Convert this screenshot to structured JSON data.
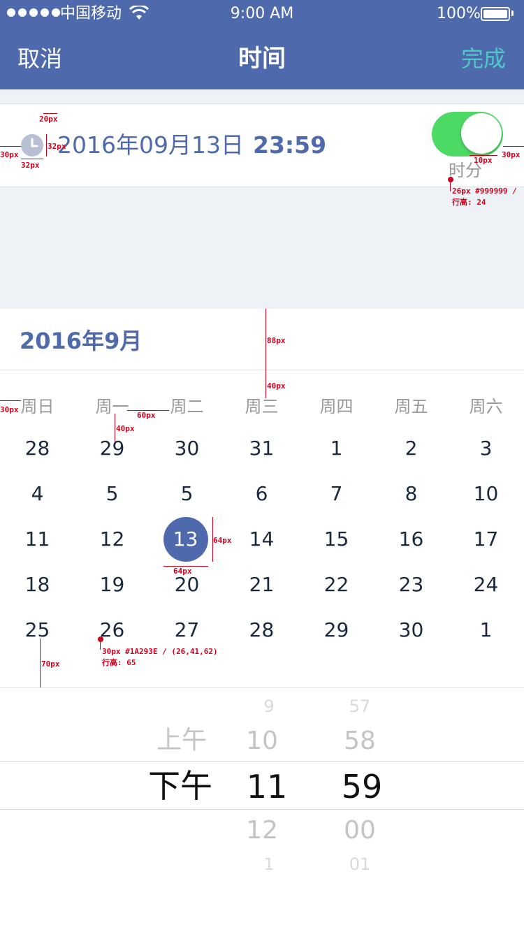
{
  "status_bar": {
    "carrier": "中国移动",
    "time": "9:00 AM",
    "battery": "100%"
  },
  "nav": {
    "cancel": "取消",
    "title": "时间",
    "done": "完成"
  },
  "date_row": {
    "date": "2016年09月13日",
    "time": "23:59",
    "toggle_on": true,
    "toggle_label": "时分"
  },
  "calendar": {
    "title": "2016年9月",
    "weekdays": [
      "周日",
      "周一",
      "周二",
      "周三",
      "周四",
      "周五",
      "周六"
    ],
    "weeks": [
      [
        "28",
        "29",
        "30",
        "31",
        "1",
        "2",
        "3"
      ],
      [
        "4",
        "5",
        "5",
        "6",
        "7",
        "8",
        "10"
      ],
      [
        "11",
        "12",
        "13",
        "14",
        "15",
        "16",
        "17"
      ],
      [
        "18",
        "19",
        "20",
        "21",
        "22",
        "23",
        "24"
      ],
      [
        "25",
        "26",
        "27",
        "28",
        "29",
        "30",
        "1"
      ]
    ],
    "selected": "13"
  },
  "picker": {
    "ampm": {
      "prev": "上午",
      "selected": "下午"
    },
    "hours": {
      "prev2": "9",
      "prev1": "10",
      "selected": "11",
      "next1": "12",
      "next2": "1"
    },
    "minutes": {
      "prev2": "57",
      "prev1": "58",
      "selected": "59",
      "next1": "00",
      "next2": "01"
    }
  },
  "colors": {
    "brand": "#4e69ac",
    "done": "#4fc8c6",
    "toggle": "#4cd964",
    "text": "#1a293e",
    "muted": "#999999",
    "annotation": "#d0021b"
  },
  "annotations": {
    "a20": "20px",
    "a32v": "32px",
    "a30l": "30px",
    "a32h": "32px",
    "a10": "10px",
    "a30r": "30px",
    "toggle_font": "26px #999999 /",
    "toggle_lh": "行高: 24",
    "a88": "88px",
    "a40a": "40px",
    "a30w": "30px",
    "a60": "60px",
    "a40b": "40px",
    "a64v": "64px",
    "a64h": "64px",
    "day_font": "30px #1A293E / (26,41,62)",
    "day_lh": "行高: 65",
    "a70": "70px"
  }
}
